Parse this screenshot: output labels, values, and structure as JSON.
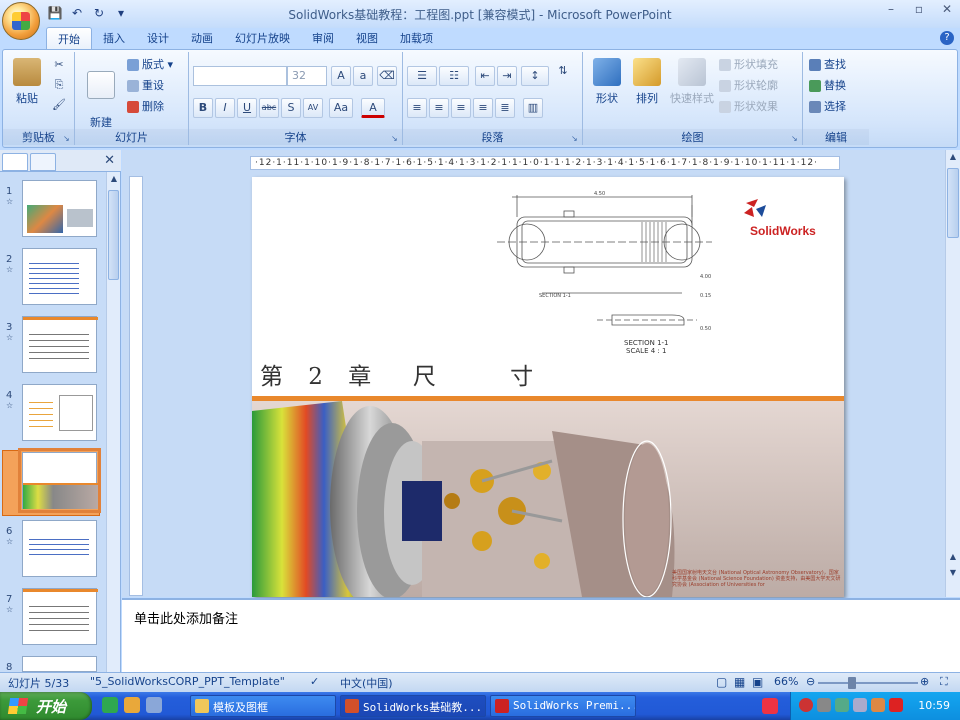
{
  "app": {
    "title": "SolidWorks基础教程：工程图.ppt [兼容模式] - Microsoft PowerPoint"
  },
  "qat": {
    "save": "💾",
    "undo": "↶",
    "redo": "↻",
    "dropdown": "▾"
  },
  "window_controls": {
    "minimize": "–",
    "restore": "▫",
    "close": "✕"
  },
  "tabs": [
    "开始",
    "插入",
    "设计",
    "动画",
    "幻灯片放映",
    "审阅",
    "视图",
    "加载项"
  ],
  "active_tab": "开始",
  "ribbon": {
    "clipboard": {
      "label": "剪贴板",
      "paste": "粘贴"
    },
    "slides": {
      "label": "幻灯片",
      "new_slide": "新建\n幻灯片",
      "layout": "版式",
      "reset": "重设",
      "delete": "删除"
    },
    "font": {
      "label": "字体",
      "font_name": "",
      "font_size": "32",
      "bold": "B",
      "italic": "I",
      "underline": "U",
      "strike": "abc",
      "shadow": "S",
      "spacing": "AV",
      "case": "Aa",
      "color": "A"
    },
    "paragraph": {
      "label": "段落"
    },
    "drawing": {
      "label": "绘图",
      "shape": "形状",
      "arrange": "排列",
      "quick_style": "快速样式",
      "fill": "形状填充",
      "outline": "形状轮廓",
      "effect": "形状效果"
    },
    "editing": {
      "label": "编辑",
      "find": "查找",
      "replace": "替换",
      "select": "选择"
    }
  },
  "slides_panel": {
    "numbers": [
      "1",
      "2",
      "3",
      "4",
      "5",
      "6",
      "7",
      "8"
    ],
    "selected": "5",
    "anim_mark": "☆"
  },
  "ruler": {
    "h_text": "·12·1·11·1·10·1·9·1·8·1·7·1·6·1·5·1·4·1·3·1·2·1·1·1·0·1·1·1·2·1·3·1·4·1·5·1·6·1·7·1·8·1·9·1·10·1·11·1·12·"
  },
  "slide": {
    "chapter_title": "第 2 章  尺    寸",
    "logo": "SolidWorks",
    "section_label": "SECTION 1-1\nSCALE 4 : 1",
    "drawing_label_small": "SECTION 1-1",
    "credit": "美国国家射电天文台 (National Optical Astronomy Observatory)，国家科学基金会 (National Science Foundation) 资金支持，由美国大学天文研究协会 (Association of Universities for"
  },
  "notes": {
    "placeholder": "单击此处添加备注"
  },
  "status": {
    "slide_info": "幻灯片 5/33",
    "template": "\"5_SolidWorksCORP_PPT_Template\"",
    "language": "中文(中国)",
    "zoom": "66%",
    "minus": "⊖",
    "plus": "⊕"
  },
  "taskbar": {
    "start": "开始",
    "tasks": [
      "模板及图框",
      "SolidWorks基础教...",
      "SolidWorks Premi..."
    ],
    "active_task": 1,
    "clock": "10:59"
  },
  "colors": {
    "accent_orange": "#e9882c",
    "logo_red": "#cc2222",
    "ribbon_bg": "#d4e5fb"
  }
}
